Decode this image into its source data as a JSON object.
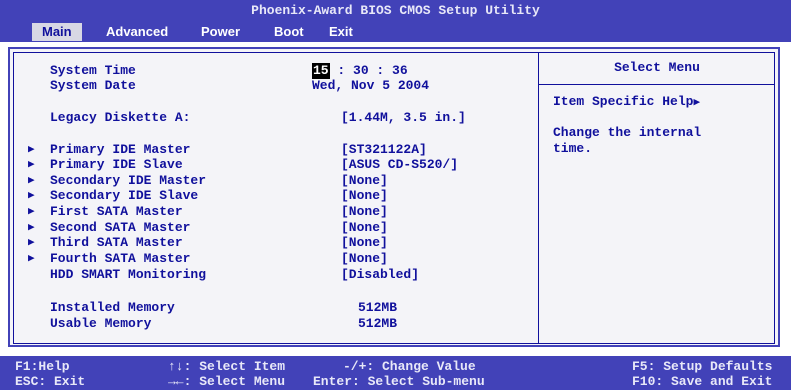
{
  "window": {
    "title": "Phoenix-Award BIOS CMOS Setup Utility"
  },
  "menu": {
    "tabs": [
      "Main",
      "Advanced",
      "Power",
      "Boot",
      "Exit"
    ],
    "active": "Main"
  },
  "main": {
    "system_time": {
      "label": "System Time",
      "hour": "15",
      "rest": " : 30 : 36"
    },
    "system_date": {
      "label": "System Date",
      "value": "Wed, Nov 5 2004"
    },
    "legacy_diskette": {
      "label": "Legacy Diskette A:",
      "value": "[1.44M, 3.5 in.]"
    },
    "devices": [
      {
        "label": "Primary IDE Master",
        "value": "[ST321122A]",
        "submenu": true
      },
      {
        "label": "Primary IDE Slave",
        "value": "[ASUS CD-S520/]",
        "submenu": true
      },
      {
        "label": "Secondary IDE Master",
        "value": "[None]",
        "submenu": true
      },
      {
        "label": "Secondary IDE Slave",
        "value": "[None]",
        "submenu": true
      },
      {
        "label": "First SATA Master",
        "value": "[None]",
        "submenu": true
      },
      {
        "label": "Second SATA Master",
        "value": "[None]",
        "submenu": true
      },
      {
        "label": "Third SATA Master",
        "value": "[None]",
        "submenu": true
      },
      {
        "label": "Fourth SATA Master",
        "value": "[None]",
        "submenu": true
      },
      {
        "label": "HDD SMART Monitoring",
        "value": "[Disabled]",
        "submenu": false
      }
    ],
    "installed_memory": {
      "label": "Installed Memory",
      "value": "512MB"
    },
    "usable_memory": {
      "label": "Usable Memory",
      "value": "512MB"
    }
  },
  "help": {
    "title": "Select Menu",
    "item_specific": "Item Specific Help",
    "text_line1": "Change the internal",
    "text_line2": "time."
  },
  "footer": {
    "f1": "F1:Help",
    "esc": "ESC: Exit",
    "updown": ": Select Item",
    "leftright": ": Select Menu",
    "plusminus": "-/+: Change Value",
    "enter": "Enter: Select Sub-menu",
    "f5": "F5: Setup Defaults",
    "f10": "F10: Save and Exit"
  }
}
